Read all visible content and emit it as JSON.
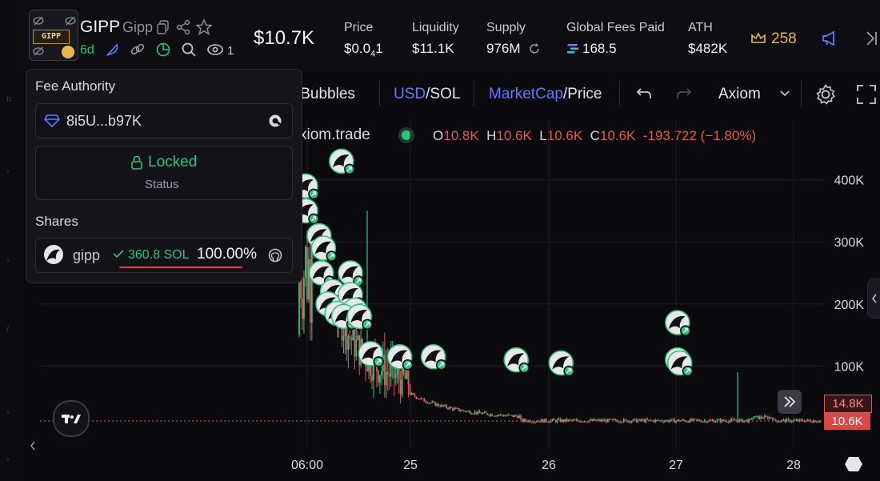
{
  "header": {
    "token_badge": "GIPP",
    "symbol": "GIPP",
    "name": "Gipp",
    "age": "6d",
    "watchers": "1",
    "market_cap": "$10.7K",
    "stats": [
      {
        "label": "Price",
        "value": "$0.0",
        "value_sub": "4",
        "value_tail": "1"
      },
      {
        "label": "Liquidity",
        "value": "$11.1K"
      },
      {
        "label": "Supply",
        "value": "976M"
      },
      {
        "label": "Global Fees Paid",
        "value": "168.5"
      },
      {
        "label": "ATH",
        "value": "$482K"
      }
    ],
    "crown_count": "258",
    "colors": {
      "accent_green": "#2ec27e",
      "accent_blue": "#5b7cff",
      "gold": "#e8b84a",
      "red": "#e05858"
    }
  },
  "chart_toolbar": {
    "bubbles": "Bubbles",
    "currency_active": "USD",
    "currency_sep": "/",
    "currency_other": "SOL",
    "mode_active": "MarketCap",
    "mode_sep": "/",
    "mode_other": "Price",
    "provider": "Axiom"
  },
  "legend": {
    "source": "xiom.trade",
    "o_label": "O",
    "o": "10.8K",
    "h_label": "H",
    "h": "10.6K",
    "l_label": "L",
    "l": "10.6K",
    "c_label": "C",
    "c": "10.6K",
    "change": "-193.722 (−1.80%)"
  },
  "popup": {
    "fee_authority_title": "Fee Authority",
    "authority_address": "8i5U...b97K",
    "locked_label": "Locked",
    "status_label": "Status",
    "shares_title": "Shares",
    "share_holder": "gipp",
    "share_sol": "360.8 SOL",
    "share_pct": "100.00%"
  },
  "chart_data": {
    "type": "candlestick",
    "y_axis": {
      "range": [
        0,
        480000
      ],
      "ticks": [
        {
          "value": 400000,
          "label": "400K"
        },
        {
          "value": 300000,
          "label": "300K"
        },
        {
          "value": 200000,
          "label": "200K"
        },
        {
          "value": 100000,
          "label": "100K"
        }
      ]
    },
    "x_axis": {
      "ticks": [
        "06:00",
        "25",
        "26",
        "27",
        "28"
      ]
    },
    "price_tags": [
      {
        "label": "14.8K",
        "value": 14800
      },
      {
        "label": "10.6K",
        "value": 10600
      }
    ],
    "grid": true,
    "up_color": "#2ec27e",
    "down_color": "#e05858",
    "trade_markers": [
      {
        "x_frac": 0.08,
        "value": 430000
      },
      {
        "x_frac": 0.0,
        "value": 390000
      },
      {
        "x_frac": 0.0,
        "value": 350000
      },
      {
        "x_frac": 0.03,
        "value": 310000
      },
      {
        "x_frac": 0.04,
        "value": 290000
      },
      {
        "x_frac": 0.035,
        "value": 250000
      },
      {
        "x_frac": 0.1,
        "value": 250000
      },
      {
        "x_frac": 0.06,
        "value": 220000
      },
      {
        "x_frac": 0.1,
        "value": 215000
      },
      {
        "x_frac": 0.05,
        "value": 200000
      },
      {
        "x_frac": 0.07,
        "value": 185000
      },
      {
        "x_frac": 0.11,
        "value": 190000
      },
      {
        "x_frac": 0.085,
        "value": 180000
      },
      {
        "x_frac": 0.12,
        "value": 180000
      },
      {
        "x_frac": 0.145,
        "value": 120000
      },
      {
        "x_frac": 0.21,
        "value": 115000
      },
      {
        "x_frac": 0.285,
        "value": 115000
      },
      {
        "x_frac": 0.47,
        "value": 110000
      },
      {
        "x_frac": 0.57,
        "value": 105000
      },
      {
        "x_frac": 0.83,
        "value": 170000
      },
      {
        "x_frac": 0.83,
        "value": 110000
      },
      {
        "x_frac": 0.835,
        "value": 105000
      }
    ]
  }
}
